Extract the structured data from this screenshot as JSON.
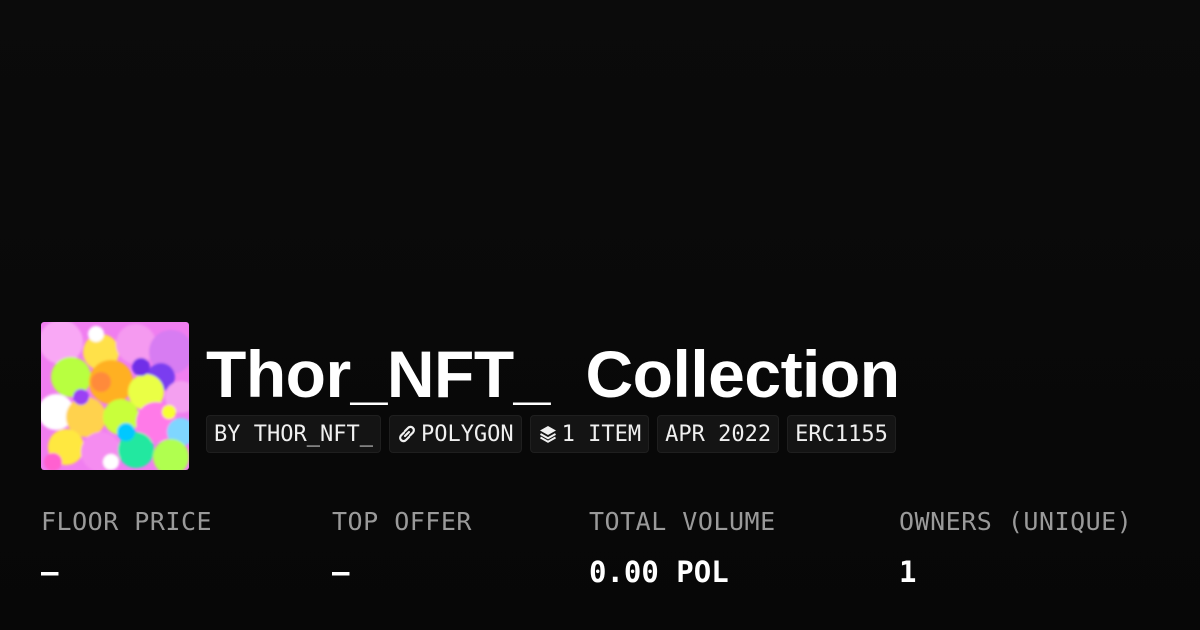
{
  "collection": {
    "title": "Thor_NFT_  Collection"
  },
  "tags": {
    "creator": "BY THOR_NFT_",
    "chain": "POLYGON",
    "items": "1 ITEM",
    "date": "APR 2022",
    "standard": "ERC1155"
  },
  "icons": {
    "chain": "polygon-link-icon",
    "items": "layers-icon"
  },
  "stats": {
    "floor_price": {
      "label": "FLOOR PRICE",
      "value": "–"
    },
    "top_offer": {
      "label": "TOP OFFER",
      "value": "–"
    },
    "total_volume": {
      "label": "TOTAL VOLUME",
      "value": "0.00 POL"
    },
    "owners": {
      "label": "OWNERS (UNIQUE)",
      "value": "1"
    }
  },
  "colors": {
    "background": "#0a0a0a",
    "tag_bg": "#141414",
    "label": "#9a9a9a",
    "text": "#ffffff"
  }
}
